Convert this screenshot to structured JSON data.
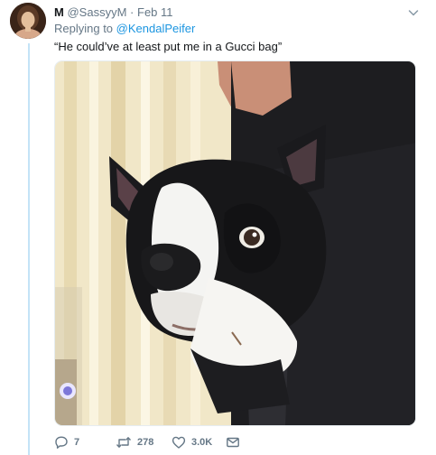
{
  "tweet": {
    "author_name": "M",
    "author_handle": "@SassyyM",
    "separator": "·",
    "date": "Feb 11",
    "reply_prefix": "Replying to",
    "reply_to": "@KendalPeifer",
    "text": "“He could’ve at least put me in a Gucci bag”",
    "media_icon": "photo-of-boston-terrier-in-bag"
  },
  "actions": {
    "reply_count": "7",
    "retweet_count": "278",
    "like_count": "3.0K"
  },
  "colors": {
    "link_blue": "#1b95e0",
    "muted_gray": "#657786",
    "thread_line": "#c4e3f7",
    "text": "#14171a"
  }
}
